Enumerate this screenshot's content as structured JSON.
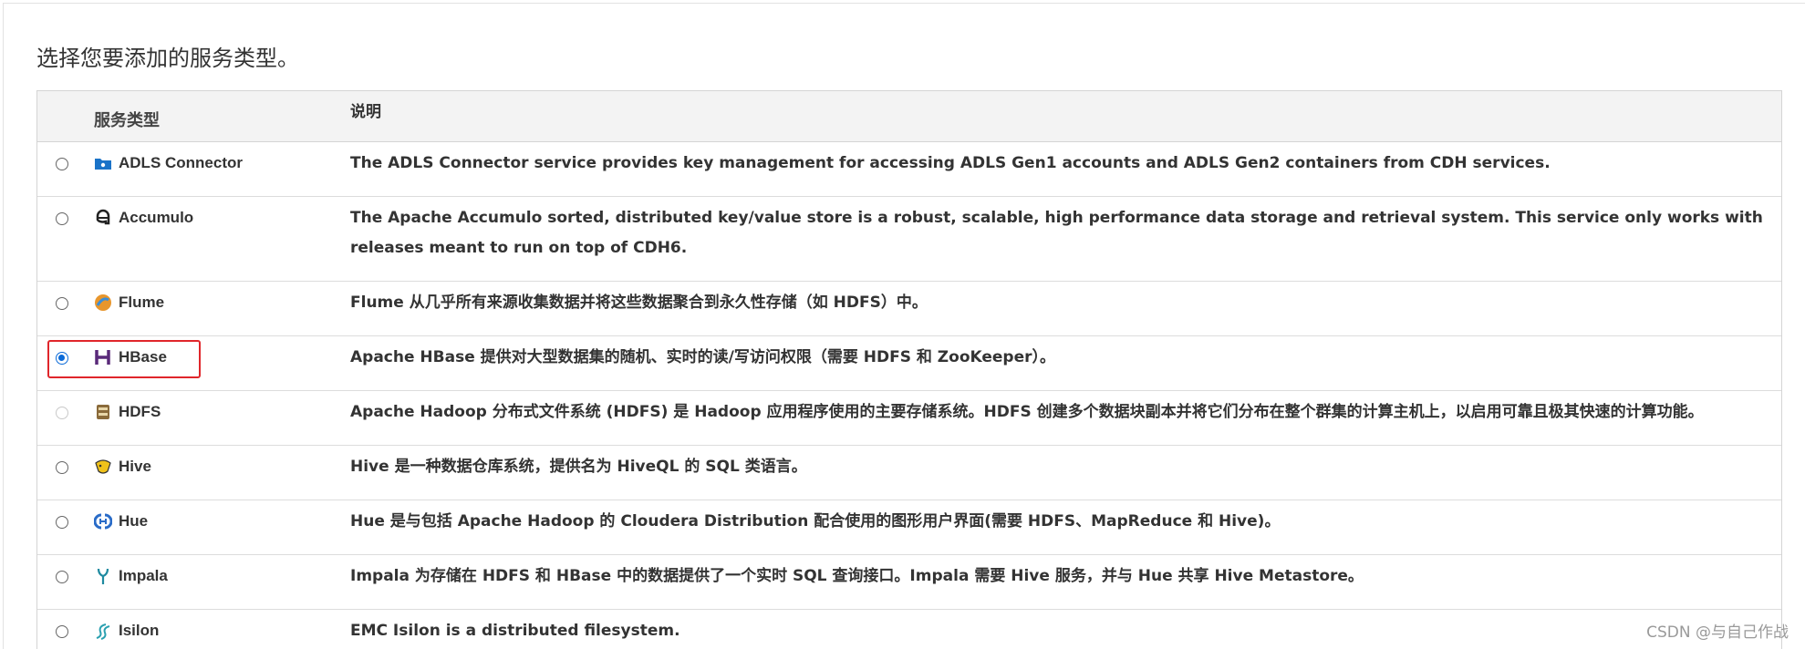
{
  "heading": "选择您要添加的服务类型。",
  "columns": {
    "type": "服务类型",
    "description": "说明"
  },
  "services": [
    {
      "name": "ADLS Connector",
      "icon": "adls-connector-icon",
      "state": "unchecked",
      "description": "The ADLS Connector service provides key management for accessing ADLS Gen1 accounts and ADLS Gen2 containers from CDH services."
    },
    {
      "name": "Accumulo",
      "icon": "accumulo-icon",
      "state": "unchecked",
      "description": "The Apache Accumulo sorted, distributed key/value store is a robust, scalable, high performance data storage and retrieval system. This service only works with releases meant to run on top of CDH6."
    },
    {
      "name": "Flume",
      "icon": "flume-icon",
      "state": "unchecked",
      "description": "Flume 从几乎所有来源收集数据并将这些数据聚合到永久性存储（如 HDFS）中。"
    },
    {
      "name": "HBase",
      "icon": "hbase-icon",
      "state": "checked",
      "highlighted": true,
      "description": "Apache HBase 提供对大型数据集的随机、实时的读/写访问权限（需要 HDFS 和 ZooKeeper）。"
    },
    {
      "name": "HDFS",
      "icon": "hdfs-icon",
      "state": "disabled",
      "description": "Apache Hadoop 分布式文件系统 (HDFS) 是 Hadoop 应用程序使用的主要存储系统。HDFS 创建多个数据块副本并将它们分布在整个群集的计算主机上，以启用可靠且极其快速的计算功能。"
    },
    {
      "name": "Hive",
      "icon": "hive-icon",
      "state": "unchecked",
      "description": "Hive 是一种数据仓库系统，提供名为 HiveQL 的 SQL 类语言。"
    },
    {
      "name": "Hue",
      "icon": "hue-icon",
      "state": "unchecked",
      "description": "Hue 是与包括 Apache Hadoop 的 Cloudera Distribution 配合使用的图形用户界面(需要 HDFS、MapReduce 和 Hive)。"
    },
    {
      "name": "Impala",
      "icon": "impala-icon",
      "state": "unchecked",
      "description": "Impala 为存储在 HDFS 和 HBase 中的数据提供了一个实时 SQL 查询接口。Impala 需要 Hive 服务，并与 Hue 共享 Hive Metastore。"
    },
    {
      "name": "Isilon",
      "icon": "isilon-icon",
      "state": "unchecked",
      "description": "EMC Isilon is a distributed filesystem."
    }
  ],
  "watermark": "CSDN @与自己作战",
  "colors": {
    "radio_checked": "#0b6ad8",
    "highlight_border": "#e0262b",
    "header_bg": "#f3f3f3"
  }
}
